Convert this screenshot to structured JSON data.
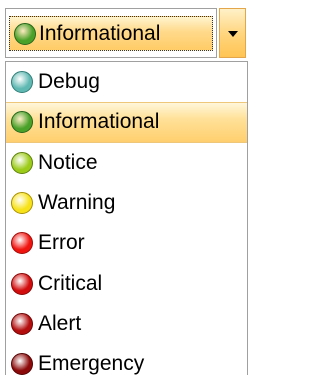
{
  "combo": {
    "selected_label": "Informational",
    "selected_color": "#4aa12a",
    "dropdown_icon": "chevron-down-icon"
  },
  "list": {
    "items": [
      {
        "label": "Debug",
        "color": "#5fb8b2",
        "border": "#2f7d78",
        "selected": false
      },
      {
        "label": "Informational",
        "color": "#4aa12a",
        "border": "#24661a",
        "selected": true
      },
      {
        "label": "Notice",
        "color": "#9ccb1a",
        "border": "#5d7f0a",
        "selected": false
      },
      {
        "label": "Warning",
        "color": "#f7e21a",
        "border": "#a88f00",
        "selected": false
      },
      {
        "label": "Error",
        "color": "#f0140f",
        "border": "#a30a07",
        "selected": false
      },
      {
        "label": "Critical",
        "color": "#d20c0c",
        "border": "#8a0505",
        "selected": false
      },
      {
        "label": "Alert",
        "color": "#b30d0d",
        "border": "#6e0505",
        "selected": false
      },
      {
        "label": "Emergency",
        "color": "#8c0909",
        "border": "#520303",
        "selected": false
      }
    ]
  }
}
